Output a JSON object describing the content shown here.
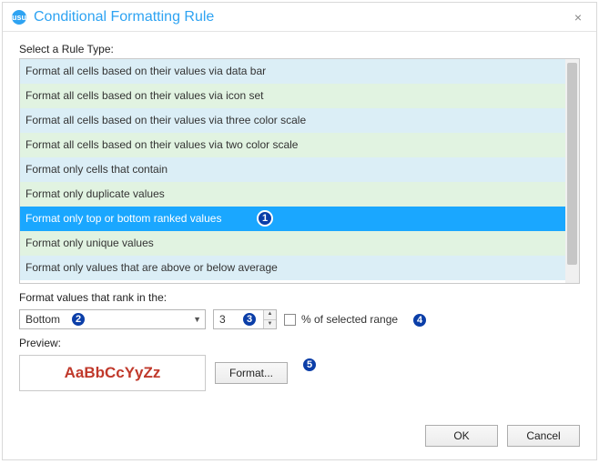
{
  "dialog": {
    "title": "Conditional Formatting Rule",
    "app_icon_label": "usu",
    "close_label": "×"
  },
  "rule_type_label": "Select a Rule Type:",
  "rule_types": [
    "Format all cells based on their values via data bar",
    "Format all cells based on their values via icon set",
    "Format all cells based on their values via three color scale",
    "Format all cells based on their values via two color scale",
    "Format only cells that contain",
    "Format only duplicate values",
    "Format only top or bottom ranked values",
    "Format only unique values",
    "Format only values that are above or below average"
  ],
  "selected_rule_index": 6,
  "config": {
    "rank_label": "Format values that rank in the:",
    "direction": "Bottom",
    "count": "3",
    "percent_of_range_label": "% of selected range",
    "percent_checked": false
  },
  "preview": {
    "label": "Preview:",
    "sample_text": "AaBbCcYyZz",
    "format_button": "Format..."
  },
  "footer": {
    "ok": "OK",
    "cancel": "Cancel"
  },
  "callouts": [
    "1",
    "2",
    "3",
    "4",
    "5"
  ]
}
